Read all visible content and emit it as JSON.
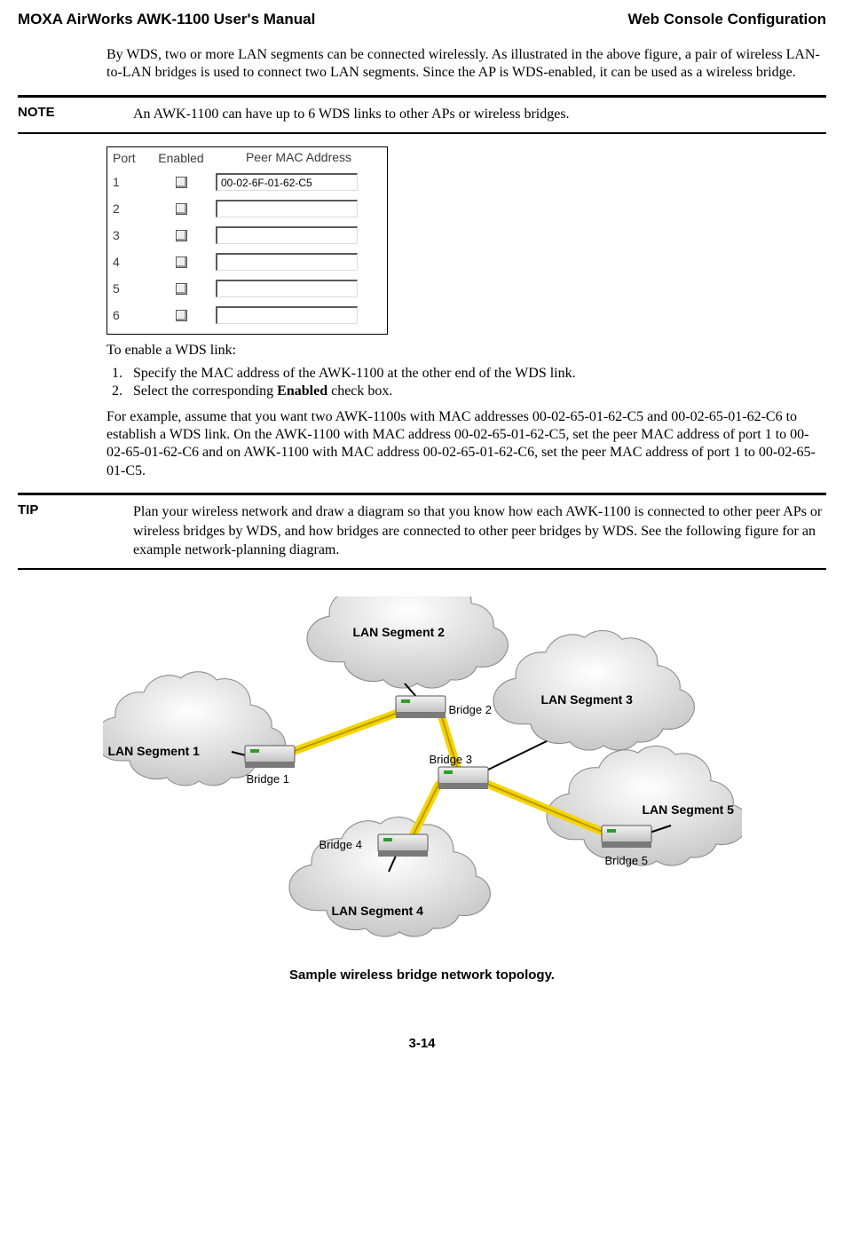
{
  "header": {
    "left": "MOXA AirWorks AWK-1100 User's Manual",
    "right": "Web Console Configuration"
  },
  "intro_paragraph": "By WDS, two or more LAN segments can be connected wirelessly. As illustrated in the above figure, a pair of wireless LAN-to-LAN bridges is used to connect two LAN segments. Since the AP is WDS-enabled, it can be used as a wireless bridge.",
  "note": {
    "label": "NOTE",
    "text": "An AWK-1100 can have up to 6 WDS links to other APs or wireless bridges."
  },
  "port_table": {
    "col_port": "Port",
    "col_enabled": "Enabled",
    "col_mac": "Peer MAC Address",
    "rows": [
      {
        "port": "1",
        "enabled": false,
        "mac": "00-02-6F-01-62-C5"
      },
      {
        "port": "2",
        "enabled": false,
        "mac": ""
      },
      {
        "port": "3",
        "enabled": false,
        "mac": ""
      },
      {
        "port": "4",
        "enabled": false,
        "mac": ""
      },
      {
        "port": "5",
        "enabled": false,
        "mac": ""
      },
      {
        "port": "6",
        "enabled": false,
        "mac": ""
      }
    ]
  },
  "enable_intro": "To enable a WDS link:",
  "steps": [
    "Specify the MAC address of the AWK-1100 at the other end of the WDS link.",
    "Select the corresponding Enabled check box."
  ],
  "step2_pre": "Select the corresponding ",
  "step2_bold": "Enabled",
  "step2_post": " check box.",
  "example_paragraph": "For example, assume that you want two AWK-1100s with MAC addresses 00-02-65-01-62-C5 and 00-02-65-01-62-C6 to establish a WDS link. On the AWK-1100 with MAC address 00-02-65-01-62-C5, set the peer MAC address of port 1 to 00-02-65-01-62-C6 and on AWK-1100 with MAC address 00-02-65-01-62-C6, set the peer MAC address of port 1 to 00-02-65-01-C5.",
  "tip": {
    "label": "TIP",
    "text": "Plan your wireless network and draw a diagram so that you know how each AWK-1100 is connected to other peer APs or wireless bridges by WDS, and how bridges are connected to other peer bridges by WDS. See the following figure for an example network-planning diagram."
  },
  "diagram": {
    "clouds": {
      "seg1": "LAN Segment 1",
      "seg2": "LAN Segment 2",
      "seg3": "LAN Segment 3",
      "seg4": "LAN Segment 4",
      "seg5": "LAN Segment 5"
    },
    "bridges": {
      "b1": "Bridge 1",
      "b2": "Bridge 2",
      "b3": "Bridge 3",
      "b4": "Bridge 4",
      "b5": "Bridge 5"
    }
  },
  "figure_caption": "Sample wireless bridge network topology.",
  "page_number": "3-14"
}
